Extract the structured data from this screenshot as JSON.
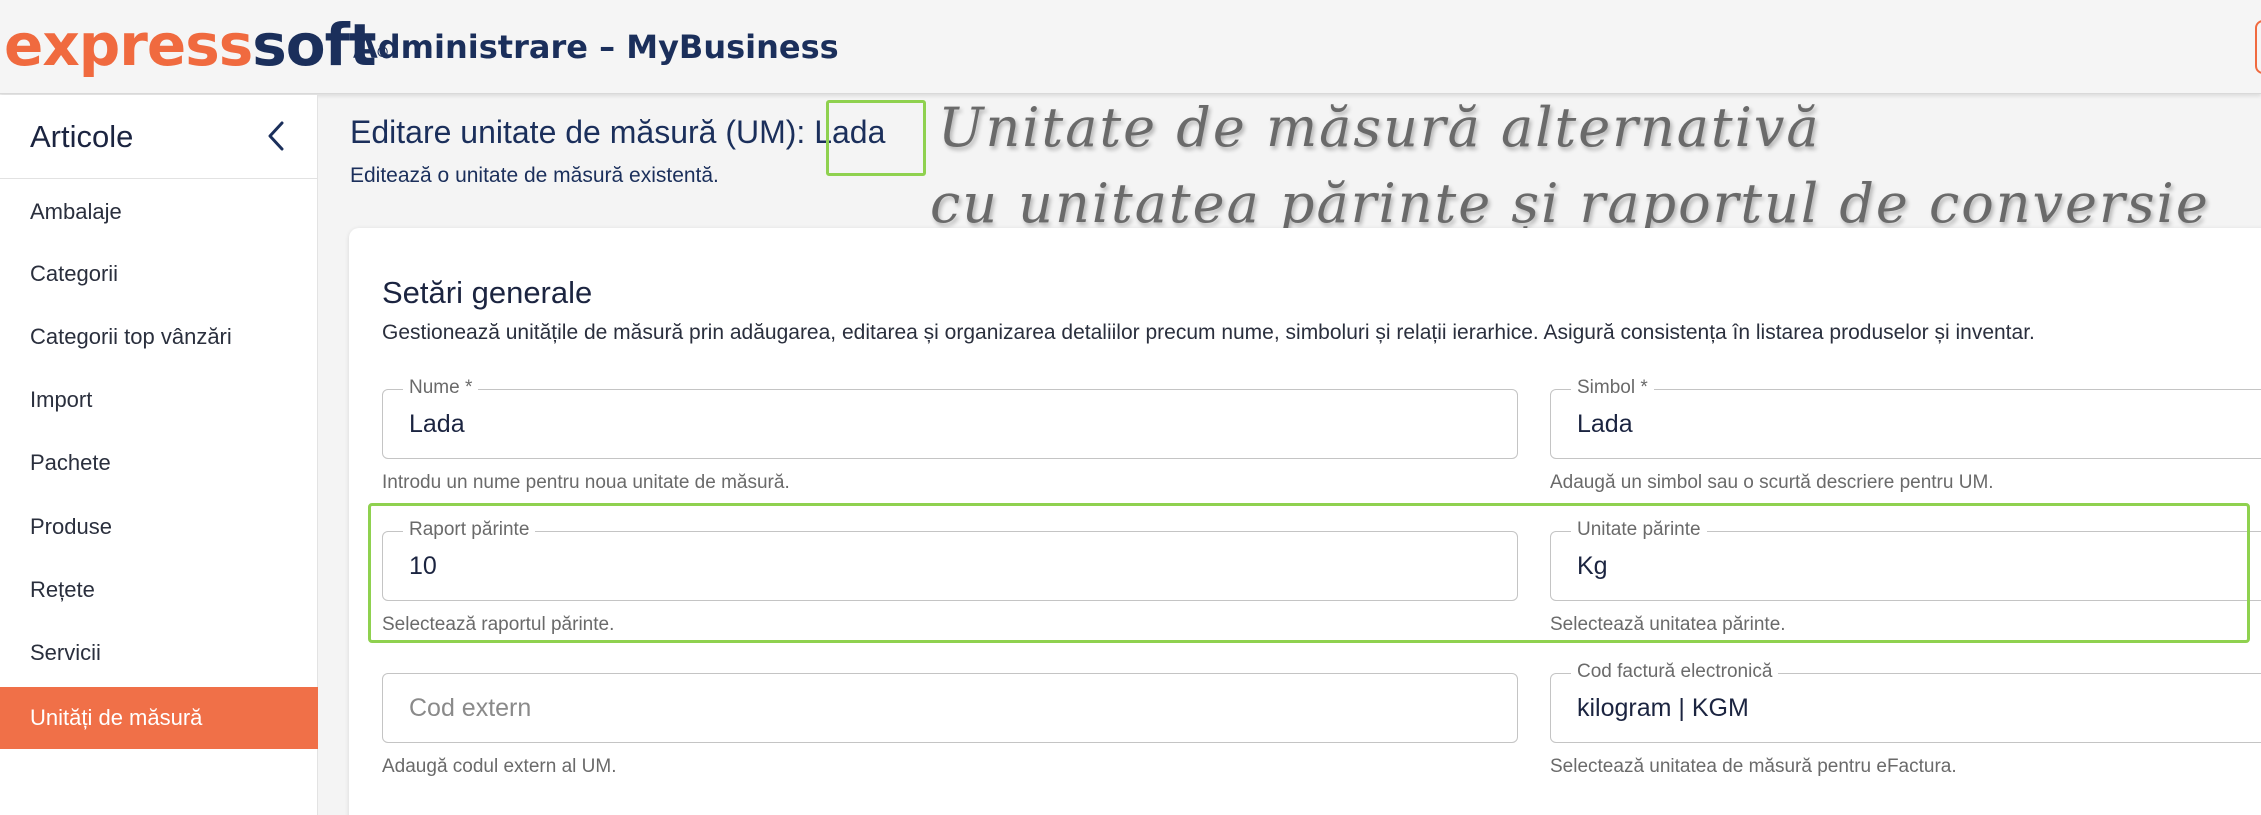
{
  "header": {
    "logo_express": "express",
    "logo_soft": "soft",
    "logo_reg": "®",
    "app_title": "Administrare – MyBusiness"
  },
  "sidebar": {
    "title": "Articole",
    "collapse_icon": "chevron-left-icon",
    "items": [
      {
        "label": "Ambalaje",
        "active": false
      },
      {
        "label": "Categorii",
        "active": false
      },
      {
        "label": "Categorii top vânzări",
        "active": false
      },
      {
        "label": "Import",
        "active": false
      },
      {
        "label": "Pachete",
        "active": false
      },
      {
        "label": "Produse",
        "active": false
      },
      {
        "label": "Rețete",
        "active": false
      },
      {
        "label": "Servicii",
        "active": false
      },
      {
        "label": "Unități de măsură",
        "active": true
      }
    ]
  },
  "page": {
    "title_prefix": "Editare unitate de măsură (UM):",
    "title_name": "Lada",
    "subtitle": "Editează o unitate de măsură existentă."
  },
  "annotation": {
    "line1": "Unitate de măsură alternativă",
    "line2": "cu unitatea părinte și raportul de conversie"
  },
  "section": {
    "title": "Setări generale",
    "description": "Gestionează unitățile de măsură prin adăugarea, editarea și organizarea detaliilor precum nume, simboluri și relații ierarhice. Asigură consistența în listarea produselor și inventar."
  },
  "form": {
    "nume": {
      "label": "Nume *",
      "value": "Lada",
      "helper": "Introdu un nume pentru noua unitate de măsură."
    },
    "simbol": {
      "label": "Simbol *",
      "value": "Lada",
      "helper": "Adaugă un simbol sau o scurtă descriere pentru UM."
    },
    "raport_parinte": {
      "label": "Raport părinte",
      "value": "10",
      "helper": "Selectează raportul părinte."
    },
    "unitate_parinte": {
      "label": "Unitate părinte",
      "value": "Kg",
      "helper": "Selectează unitatea părinte."
    },
    "cod_extern": {
      "placeholder": "Cod extern",
      "helper": "Adaugă codul extern al UM."
    },
    "cod_factura": {
      "label": "Cod factură electronică",
      "value": "kilogram | KGM",
      "helper": "Selectează unitatea de măsură pentru eFactura."
    }
  },
  "colors": {
    "brand_orange": "#f06a3f",
    "brand_navy": "#1b2f5b",
    "highlight_green": "#8fd14f"
  }
}
